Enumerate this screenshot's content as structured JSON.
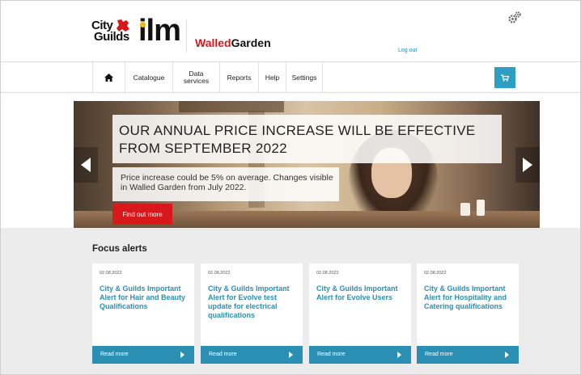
{
  "header": {
    "logo_city": "City",
    "logo_guilds": "Guilds",
    "logo_ilm": "ilm",
    "brand_walled": "Walled",
    "brand_garden": "Garden",
    "logout": "Log out",
    "settings_icon": "gears-icon"
  },
  "nav": {
    "home_icon": "home-icon",
    "items": [
      {
        "label": "Catalogue"
      },
      {
        "label": "Data\nservices"
      },
      {
        "label": "Reports"
      },
      {
        "label": "Help"
      },
      {
        "label": "Settings"
      }
    ],
    "cart_icon": "cart-icon"
  },
  "hero": {
    "title": "OUR ANNUAL PRICE INCREASE WILL BE EFFECTIVE FROM SEPTEMBER 2022",
    "subtitle": "Price increase could be 5% on average. Changes visible in Walled Garden from July 2022.",
    "cta": "Find out more",
    "prev_icon": "chevron-left-icon",
    "next_icon": "chevron-right-icon"
  },
  "alerts": {
    "heading": "Focus alerts",
    "cards": [
      {
        "date": "02.08.2022",
        "title": "City & Guilds Important Alert for Hair and Beauty Qualifications",
        "more": "Read more"
      },
      {
        "date": "02.08.2022",
        "title": "City & Guilds Important Alert for Evolve test update for electrical qualifications",
        "more": "Read more"
      },
      {
        "date": "02.08.2022",
        "title": "City & Guilds Important Alert for Evolve Users",
        "more": "Read more"
      },
      {
        "date": "02.08.2022",
        "title": "City & Guilds Important Alert for Hospitality and Catering qualifications",
        "more": "Read more"
      }
    ]
  },
  "colors": {
    "brand_red": "#d7191c",
    "accent_blue": "#2b8fb3",
    "section_bg": "#ececec"
  }
}
